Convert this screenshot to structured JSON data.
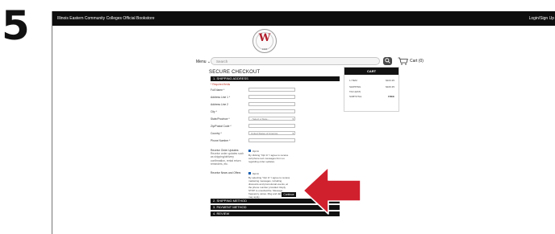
{
  "step_number": "5",
  "topbar": {
    "store_name": "Illinois Eastern Community Colleges Official Bookstore",
    "login": "Login/Sign Up"
  },
  "logo": {
    "letter": "W",
    "ring_text": "1966"
  },
  "header": {
    "menu_label": "Menu",
    "search_placeholder": "Search",
    "cart_label": "Cart (0)"
  },
  "checkout": {
    "title": "SECURE CHECKOUT",
    "sections": [
      "1. SHIPPING ADDRESS",
      "2. SHIPPING METHOD",
      "3. PAYMENT METHOD",
      "4. REVIEW"
    ],
    "required_note": "* Required fields",
    "fields": [
      {
        "label": "Full Name *"
      },
      {
        "label": "Address Line 1 *"
      },
      {
        "label": "Address Line 2"
      },
      {
        "label": "City *"
      },
      {
        "label": "State/Province *",
        "value": "- Select a State -"
      },
      {
        "label": "Zip/Postal Code *"
      },
      {
        "label": "Country *",
        "value": "United States of America"
      },
      {
        "label": "Phone Number *"
      }
    ],
    "order_updates": {
      "label": "Receive Order Updates:",
      "sub_label": "Receive order updates such as shipping/delivery confirmation, rental return reminders, etc.",
      "checkbox_text": "Opt In",
      "desc": "By clicking \"Opt In\" I agree to receive cell phone text messages from us regarding order updates."
    },
    "news_offers": {
      "label": "Receive News and Offers",
      "checkbox_text": "Opt In",
      "desc": "By selecting \"Opt In\" I agree to receive marketing messages, including discounts and promotional events, at the phone number provided. Reply STOP to unsubscribe. Message frequency varies. Msg and data rates may apply."
    },
    "continue_label": "Continue"
  },
  "cart": {
    "title": "CART",
    "rows": [
      {
        "label": "1 ITEM",
        "value": "$103.35"
      },
      {
        "label": "SHIPPING",
        "value": "$106.35"
      },
      {
        "label": "TAX (EST)",
        "value": ""
      },
      {
        "label": "SUBTOTAL",
        "value": "FREE"
      }
    ]
  },
  "colors": {
    "brand_red": "#b11e2b",
    "bar_black": "#121212",
    "arrow_red": "#d0202e",
    "checkbox_blue": "#1f73d1"
  }
}
